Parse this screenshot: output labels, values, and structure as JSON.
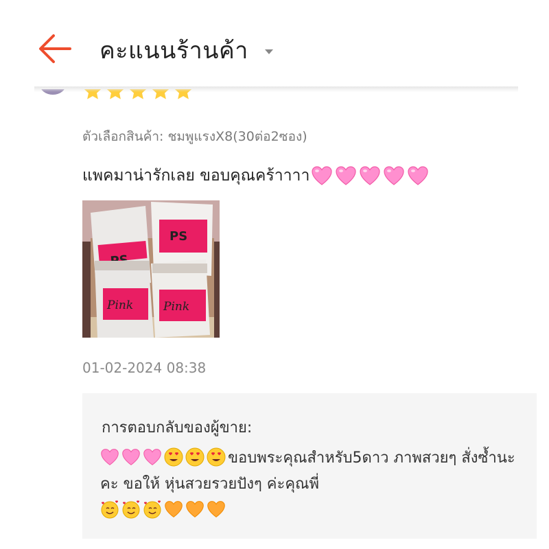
{
  "header": {
    "back_icon": "arrow-left-icon",
    "title": "คะแนนร้านค้า",
    "dropdown_icon": "caret-down-icon",
    "accent_color": "#ee4d2d"
  },
  "review": {
    "rating": 5,
    "rating_max": 5,
    "star_color": "#ffce3d",
    "variation": "ตัวเลือกสินค้า: ชมพูแรงX8(30ต่อ2ซอง)",
    "comment": "แพคมาน่ารักเลย ขอบคุณคร้าาาา",
    "comment_emojis": [
      "pink-heart",
      "pink-heart",
      "pink-heart",
      "pink-heart",
      "pink-heart"
    ],
    "photo": {
      "label_ps": "PS",
      "label_pink": "Pink"
    },
    "timestamp": "01-02-2024 08:38"
  },
  "seller_reply": {
    "label": "การตอบกลับของผู้ขาย:",
    "lead_emojis": [
      "pink-heart",
      "pink-heart",
      "pink-heart",
      "heart-eyes",
      "heart-eyes",
      "heart-eyes"
    ],
    "text": "ขอบพระคุณสำหรับ5ดาว ภาพสวยๆ สั่งซ้ำนะคะ ขอให้ หุ่นสวยรวยปังๆ ค่ะคุณพี่",
    "trail_emojis": [
      "smiling-face-with-hearts",
      "smiling-face-with-hearts",
      "smiling-face-with-hearts",
      "orange-heart",
      "orange-heart",
      "orange-heart"
    ]
  }
}
